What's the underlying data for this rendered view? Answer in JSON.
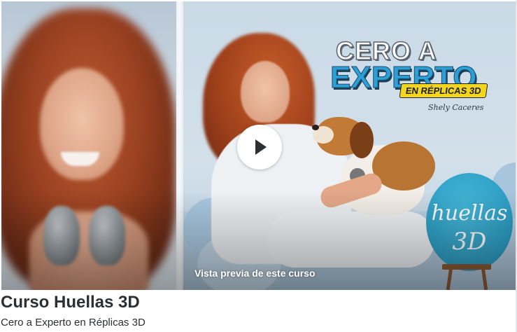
{
  "preview": {
    "label": "Vista previa de este curso",
    "image_title_line1": "CERO A",
    "image_title_line2": "EXPERTO",
    "image_badge": "EN RÉPLICAS 3D",
    "image_signature": "Shely Caceres",
    "image_sign_word1": "huellas",
    "image_sign_word2": "3D"
  },
  "course": {
    "title": "Curso Huellas 3D",
    "subtitle": "Cero a Experto en Réplicas 3D"
  },
  "colors": {
    "text": "#2d2f31",
    "accent_blue": "#2b9fd6",
    "badge_yellow": "#f2d51d"
  },
  "icons": {
    "play": "play-icon"
  }
}
